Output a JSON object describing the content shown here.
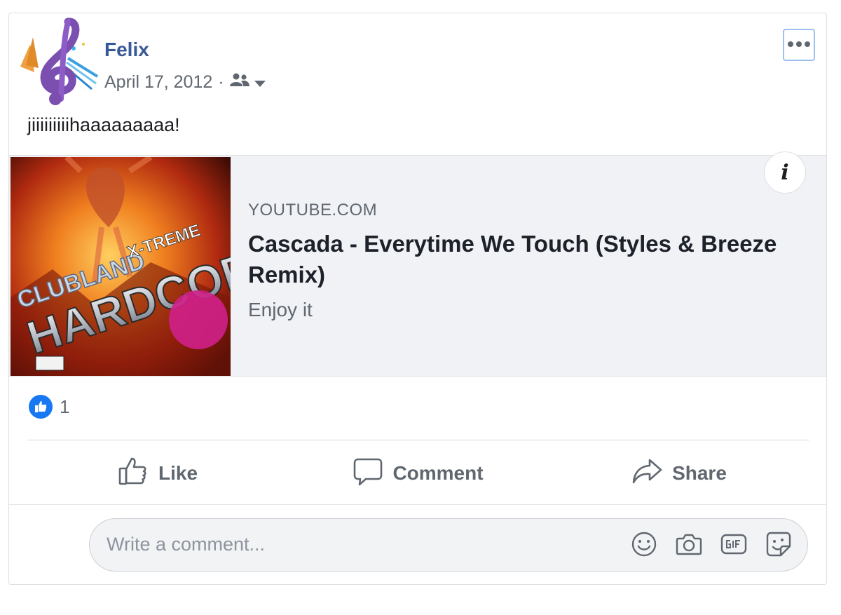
{
  "post": {
    "author": "Felix",
    "date": "April 17, 2012",
    "separator": "·",
    "audience_icon": "friends-icon",
    "text": "jiiiiiiiiihaaaaaaaaa!",
    "more_icon": "more-options-icon"
  },
  "link_preview": {
    "domain": "YOUTUBE.COM",
    "title": "Cascada - Everytime We Touch (Styles & Breeze Remix)",
    "description": "Enjoy it",
    "info_label": "i",
    "thumbnail": {
      "brand_text": "CLUBLAND",
      "subtitle_text": "X-TREME",
      "main_text": "HARDCORE"
    }
  },
  "reactions": {
    "count": "1",
    "icon": "like-reaction-icon",
    "color": "#1877f2"
  },
  "actions": {
    "like_label": "Like",
    "comment_label": "Comment",
    "share_label": "Share"
  },
  "comment_box": {
    "placeholder": "Write a comment...",
    "icons": [
      "emoji-icon",
      "camera-icon",
      "gif-icon",
      "sticker-icon"
    ]
  },
  "colors": {
    "author": "#385898",
    "secondary_text": "#606770",
    "accent": "#1877f2"
  }
}
